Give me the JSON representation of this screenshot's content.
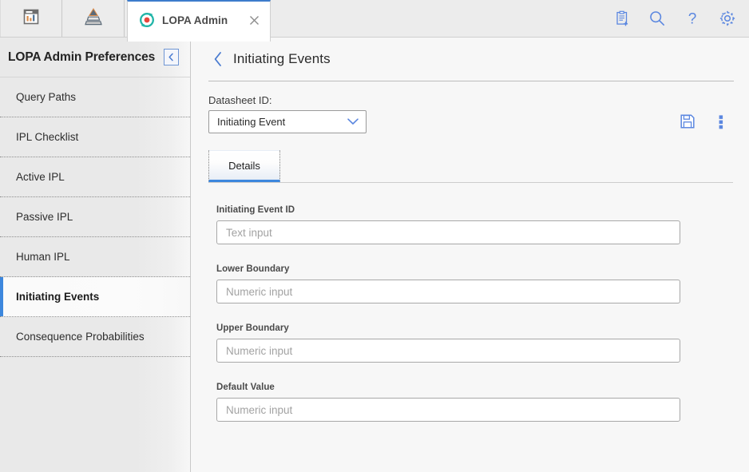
{
  "topbar": {
    "left_icons": [
      {
        "name": "dashboard-icon",
        "title": "Dashboard"
      },
      {
        "name": "pyramid-icon",
        "title": "Hierarchy"
      }
    ],
    "tab": {
      "label": "LOPA Admin",
      "icon": "lopa-admin-icon",
      "close_label": "Close tab"
    },
    "right_icons": [
      {
        "name": "new-record-icon",
        "title": "New"
      },
      {
        "name": "search-icon",
        "title": "Search"
      },
      {
        "name": "help-icon",
        "title": "Help"
      },
      {
        "name": "gear-icon",
        "title": "Settings"
      }
    ]
  },
  "sidebar": {
    "title": "LOPA Admin Preferences",
    "collapse_title": "Collapse panel",
    "items": [
      {
        "label": "Query Paths",
        "active": false
      },
      {
        "label": "IPL Checklist",
        "active": false
      },
      {
        "label": "Active IPL",
        "active": false
      },
      {
        "label": "Passive IPL",
        "active": false
      },
      {
        "label": "Human IPL",
        "active": false
      },
      {
        "label": "Initiating Events",
        "active": true
      },
      {
        "label": "Consequence Probabilities",
        "active": false
      }
    ]
  },
  "main": {
    "page_title": "Initiating Events",
    "back_title": "Back",
    "datasheet": {
      "label": "Datasheet ID:",
      "value": "Initiating Event"
    },
    "actions": [
      {
        "name": "save-icon",
        "title": "Save"
      },
      {
        "name": "more-options-icon",
        "title": "More options"
      }
    ],
    "tabs": [
      {
        "label": "Details",
        "active": true
      }
    ],
    "fields": [
      {
        "label": "Initiating Event ID",
        "placeholder": "Text input",
        "value": ""
      },
      {
        "label": "Lower Boundary",
        "placeholder": "Numeric input",
        "value": ""
      },
      {
        "label": "Upper Boundary",
        "placeholder": "Numeric input",
        "value": ""
      },
      {
        "label": "Default Value",
        "placeholder": "Numeric input",
        "value": ""
      }
    ]
  },
  "colors": {
    "accent_blue": "#3d87dd",
    "icon_blue": "#5b87e0",
    "tab_top_blue": "#3d7ccc",
    "tab_icon_teal": "#21b5a8",
    "tab_icon_red": "#e8453c",
    "sidebar_bg": "#e9e9e9",
    "content_bg": "#f7f7f7"
  }
}
